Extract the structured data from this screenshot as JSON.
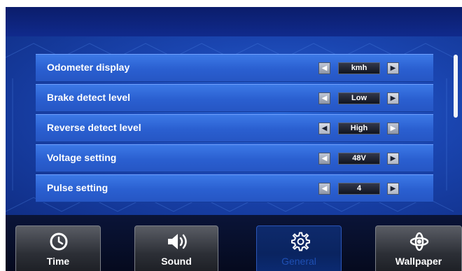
{
  "settings": [
    {
      "label": "Odometer display",
      "value": "kmh",
      "left_enabled": false,
      "right_enabled": true
    },
    {
      "label": "Brake detect level",
      "value": "Low",
      "left_enabled": false,
      "right_enabled": true
    },
    {
      "label": "Reverse detect level",
      "value": "High",
      "left_enabled": true,
      "right_enabled": false
    },
    {
      "label": "Voltage setting",
      "value": "48V",
      "left_enabled": false,
      "right_enabled": true
    },
    {
      "label": "Pulse setting",
      "value": "4",
      "left_enabled": false,
      "right_enabled": true
    }
  ],
  "tabs": [
    {
      "label": "Time",
      "icon": "clock-icon",
      "active": false
    },
    {
      "label": "Sound",
      "icon": "speaker-icon",
      "active": false
    },
    {
      "label": "General",
      "icon": "gear-icon",
      "active": true
    },
    {
      "label": "Wallpaper",
      "icon": "flower-icon",
      "active": false
    }
  ],
  "colors": {
    "row": "#2a5fd0",
    "background": "#0a1a5c",
    "active_tab_text": "#1e4fb4"
  }
}
